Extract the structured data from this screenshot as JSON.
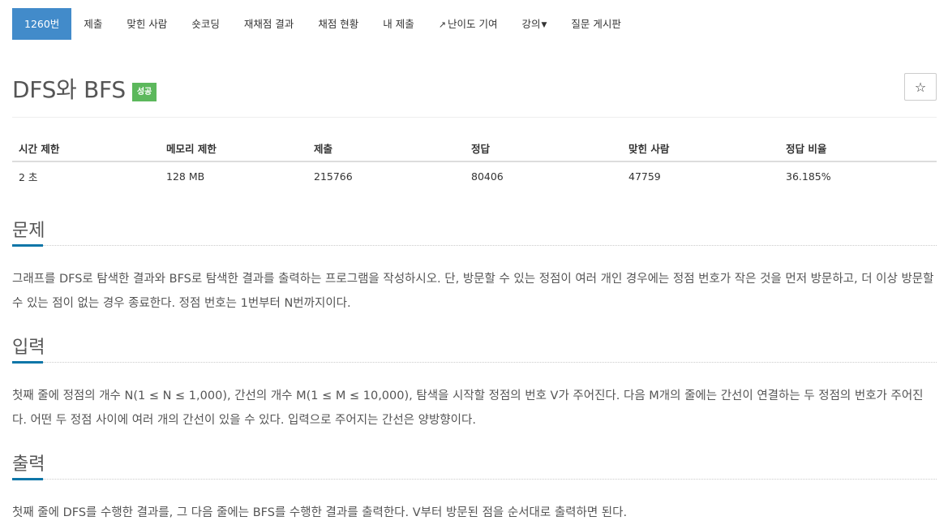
{
  "tabs": [
    {
      "label": "1260번",
      "active": true
    },
    {
      "label": "제출"
    },
    {
      "label": "맞힌 사람"
    },
    {
      "label": "숏코딩"
    },
    {
      "label": "재채점 결과"
    },
    {
      "label": "채점 현황"
    },
    {
      "label": "내 제출"
    },
    {
      "label": "난이도 기여",
      "icon": "external-link-icon"
    },
    {
      "label": "강의",
      "icon": "caret-down-icon"
    },
    {
      "label": "질문 게시판"
    }
  ],
  "problem": {
    "title": "DFS와 BFS",
    "badge": "성공",
    "star_icon": "☆"
  },
  "info_table": {
    "headers": [
      "시간 제한",
      "메모리 제한",
      "제출",
      "정답",
      "맞힌 사람",
      "정답 비율"
    ],
    "row": [
      "2 초",
      "128 MB",
      "215766",
      "80406",
      "47759",
      "36.185%"
    ]
  },
  "sections": {
    "description": {
      "title": "문제",
      "text": "그래프를 DFS로 탐색한 결과와 BFS로 탐색한 결과를 출력하는 프로그램을 작성하시오. 단, 방문할 수 있는 정점이 여러 개인 경우에는 정점 번호가 작은 것을 먼저 방문하고, 더 이상 방문할 수 있는 점이 없는 경우 종료한다. 정점 번호는 1번부터 N번까지이다."
    },
    "input": {
      "title": "입력",
      "text": "첫째 줄에 정점의 개수 N(1 ≤ N ≤ 1,000), 간선의 개수 M(1 ≤ M ≤ 10,000), 탐색을 시작할 정점의 번호 V가 주어진다. 다음 M개의 줄에는 간선이 연결하는 두 정점의 번호가 주어진다. 어떤 두 정점 사이에 여러 개의 간선이 있을 수 있다. 입력으로 주어지는 간선은 양방향이다."
    },
    "output": {
      "title": "출력",
      "text": "첫째 줄에 DFS를 수행한 결과를, 그 다음 줄에는 BFS를 수행한 결과를 출력한다. V부터 방문된 점을 순서대로 출력하면 된다."
    }
  },
  "colors": {
    "tab_active": "#428bca",
    "badge_success": "#5cb85c",
    "section_accent": "#0e76a8"
  }
}
